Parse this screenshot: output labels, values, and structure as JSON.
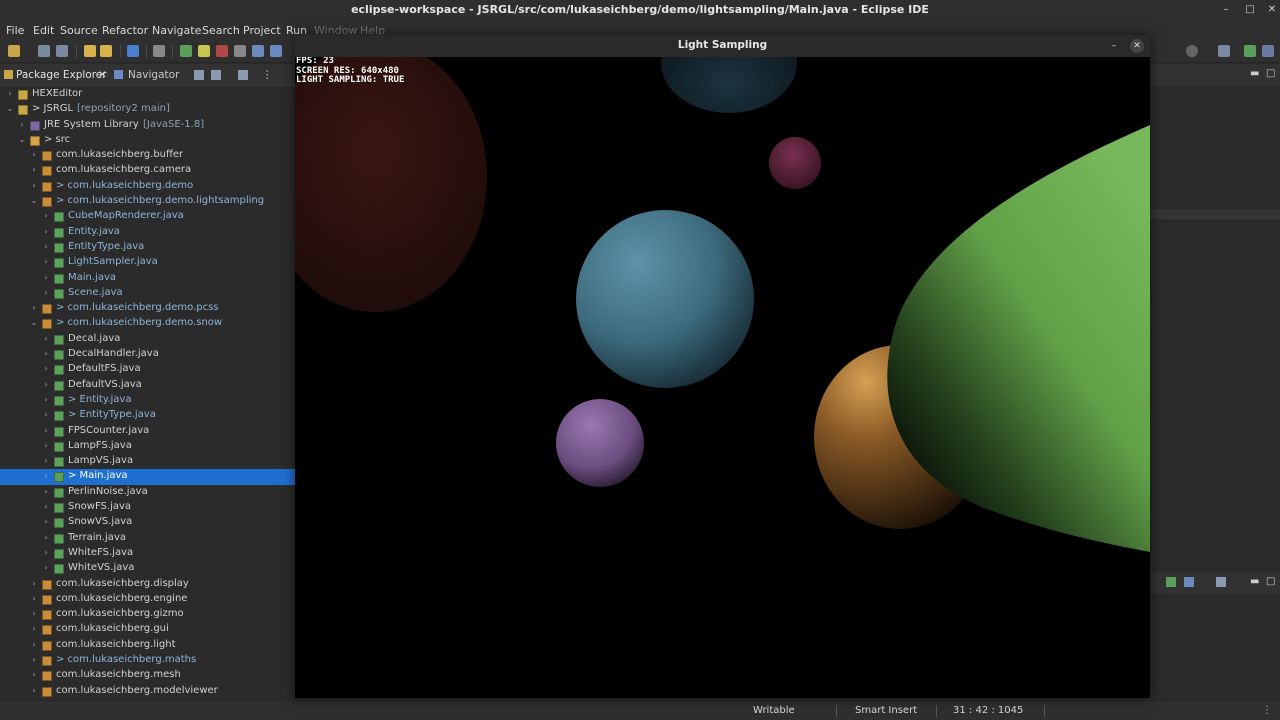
{
  "window": {
    "title": "eclipse-workspace - JSRGL/src/com/lukaseichberg/demo/lightsampling/Main.java - Eclipse IDE"
  },
  "menubar": [
    "File",
    "Edit",
    "Source",
    "Refactor",
    "Navigate",
    "Search",
    "Project",
    "Run",
    "Window",
    "Help"
  ],
  "views": {
    "package_explorer": "Package Explorer",
    "navigator": "Navigator"
  },
  "tree": [
    {
      "label": "HEXEditor",
      "icon": "project-icon",
      "depth": 0,
      "twisty": "›"
    },
    {
      "label": "> JSRGL",
      "decoration": "[repository2 main]",
      "icon": "project-icon",
      "depth": 0,
      "twisty": "⌄"
    },
    {
      "label": "JRE System Library",
      "decoration": "[JavaSE-1.8]",
      "icon": "library-icon",
      "depth": 1,
      "twisty": "›"
    },
    {
      "label": "> src",
      "icon": "folder-icon",
      "depth": 1,
      "twisty": "⌄"
    },
    {
      "label": "com.lukaseichberg.buffer",
      "icon": "package-icon",
      "depth": 2,
      "twisty": "›"
    },
    {
      "label": "com.lukaseichberg.camera",
      "icon": "package-icon",
      "depth": 2,
      "twisty": "›"
    },
    {
      "label": "> com.lukaseichberg.demo",
      "icon": "package-icon",
      "depth": 2,
      "twisty": "›",
      "blue": true
    },
    {
      "label": "> com.lukaseichberg.demo.lightsampling",
      "icon": "package-icon",
      "depth": 2,
      "twisty": "⌄",
      "blue": true
    },
    {
      "label": "CubeMapRenderer.java",
      "icon": "java-file-icon",
      "depth": 3,
      "twisty": "›",
      "blue": true
    },
    {
      "label": "Entity.java",
      "icon": "java-file-icon",
      "depth": 3,
      "twisty": "›",
      "blue": true
    },
    {
      "label": "EntityType.java",
      "icon": "java-file-icon",
      "depth": 3,
      "twisty": "›",
      "blue": true
    },
    {
      "label": "LightSampler.java",
      "icon": "java-file-icon",
      "depth": 3,
      "twisty": "›",
      "blue": true
    },
    {
      "label": "Main.java",
      "icon": "java-file-icon",
      "depth": 3,
      "twisty": "›",
      "blue": true
    },
    {
      "label": "Scene.java",
      "icon": "java-file-icon",
      "depth": 3,
      "twisty": "›",
      "blue": true
    },
    {
      "label": "> com.lukaseichberg.demo.pcss",
      "icon": "package-icon",
      "depth": 2,
      "twisty": "›",
      "blue": true
    },
    {
      "label": "> com.lukaseichberg.demo.snow",
      "icon": "package-icon",
      "depth": 2,
      "twisty": "⌄",
      "blue": true
    },
    {
      "label": "Decal.java",
      "icon": "java-file-icon",
      "depth": 3,
      "twisty": "›"
    },
    {
      "label": "DecalHandler.java",
      "icon": "java-file-icon",
      "depth": 3,
      "twisty": "›"
    },
    {
      "label": "DefaultFS.java",
      "icon": "java-file-icon",
      "depth": 3,
      "twisty": "›"
    },
    {
      "label": "DefaultVS.java",
      "icon": "java-file-icon",
      "depth": 3,
      "twisty": "›"
    },
    {
      "label": "> Entity.java",
      "icon": "java-file-icon",
      "depth": 3,
      "twisty": "›",
      "blue": true
    },
    {
      "label": "> EntityType.java",
      "icon": "java-file-icon",
      "depth": 3,
      "twisty": "›",
      "blue": true
    },
    {
      "label": "FPSCounter.java",
      "icon": "java-file-icon",
      "depth": 3,
      "twisty": "›"
    },
    {
      "label": "LampFS.java",
      "icon": "java-file-icon",
      "depth": 3,
      "twisty": "›"
    },
    {
      "label": "LampVS.java",
      "icon": "java-file-icon",
      "depth": 3,
      "twisty": "›"
    },
    {
      "label": "> Main.java",
      "icon": "java-file-icon",
      "depth": 3,
      "twisty": "›",
      "selected": true
    },
    {
      "label": "PerlinNoise.java",
      "icon": "java-file-icon",
      "depth": 3,
      "twisty": "›"
    },
    {
      "label": "SnowFS.java",
      "icon": "java-file-icon",
      "depth": 3,
      "twisty": "›"
    },
    {
      "label": "SnowVS.java",
      "icon": "java-file-icon",
      "depth": 3,
      "twisty": "›"
    },
    {
      "label": "Terrain.java",
      "icon": "java-file-icon",
      "depth": 3,
      "twisty": "›"
    },
    {
      "label": "WhiteFS.java",
      "icon": "java-file-icon",
      "depth": 3,
      "twisty": "›"
    },
    {
      "label": "WhiteVS.java",
      "icon": "java-file-icon",
      "depth": 3,
      "twisty": "›"
    },
    {
      "label": "com.lukaseichberg.display",
      "icon": "package-icon",
      "depth": 2,
      "twisty": "›"
    },
    {
      "label": "com.lukaseichberg.engine",
      "icon": "package-icon",
      "depth": 2,
      "twisty": "›"
    },
    {
      "label": "com.lukaseichberg.gizmo",
      "icon": "package-icon",
      "depth": 2,
      "twisty": "›"
    },
    {
      "label": "com.lukaseichberg.gui",
      "icon": "package-icon",
      "depth": 2,
      "twisty": "›"
    },
    {
      "label": "com.lukaseichberg.light",
      "icon": "package-icon",
      "depth": 2,
      "twisty": "›"
    },
    {
      "label": "> com.lukaseichberg.maths",
      "icon": "package-icon",
      "depth": 2,
      "twisty": "›",
      "blue": true
    },
    {
      "label": "com.lukaseichberg.mesh",
      "icon": "package-icon",
      "depth": 2,
      "twisty": "›"
    },
    {
      "label": "com.lukaseichberg.modelviewer",
      "icon": "package-icon",
      "depth": 2,
      "twisty": "›"
    }
  ],
  "light_window": {
    "title": "Light Sampling",
    "hud": [
      "FPS: 23",
      "SCREEN RES: 640x480",
      "LIGHT SAMPLING: TRUE"
    ]
  },
  "statusbar": {
    "mode": "Writable",
    "insert": "Smart Insert",
    "position": "31 : 42 : 1045"
  },
  "colors": {
    "selection": "#1f6fd1",
    "decoration": "#8aa4b8",
    "blue_label": "#8fb4d9"
  }
}
